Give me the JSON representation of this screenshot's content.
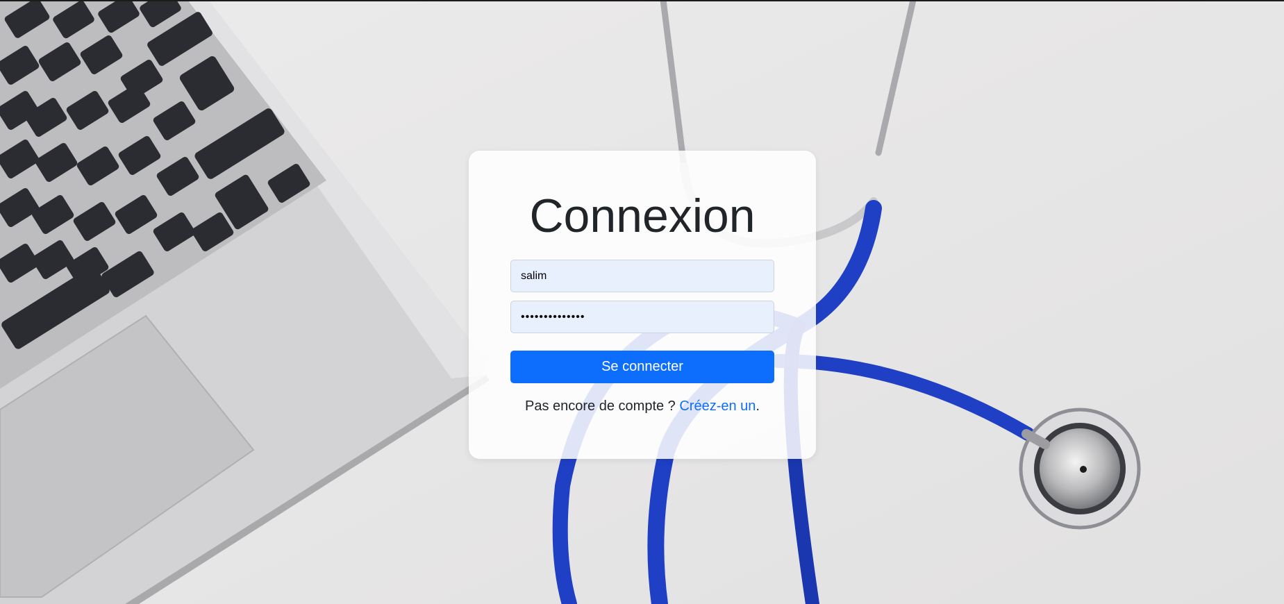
{
  "login": {
    "title": "Connexion",
    "username_value": "salim",
    "password_value": "••••••••••••••",
    "submit_label": "Se connecter",
    "signup_prompt": "Pas encore de compte ? ",
    "signup_link": "Créez-en un",
    "signup_suffix": "."
  },
  "colors": {
    "primary": "#0d6efd",
    "input_autofill_bg": "#e8f0fe",
    "stethoscope_tube": "#1f3fc4",
    "background": "#e9e8e9",
    "laptop_body": "#cfcfd1",
    "keyboard_keys": "#2a2c31"
  },
  "background_image": {
    "subject": "laptop and stethoscope on desk",
    "icon": "background-photo"
  }
}
